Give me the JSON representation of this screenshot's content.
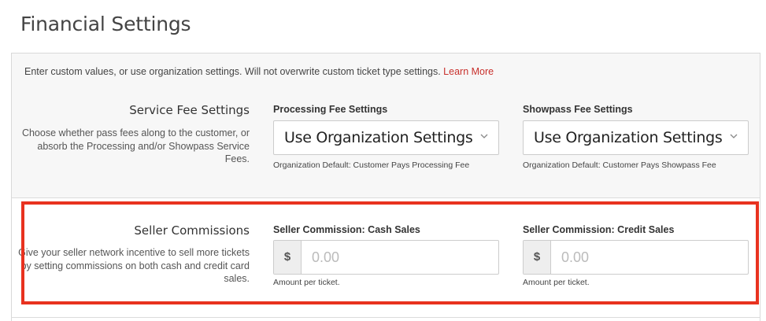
{
  "page": {
    "title": "Financial Settings"
  },
  "intro": {
    "text": "Enter custom values, or use organization settings. Will not overwrite custom ticket type settings. ",
    "link": "Learn More"
  },
  "service_fee": {
    "title": "Service Fee Settings",
    "description": "Choose whether pass fees along to the customer, or absorb the Processing and/or Showpass Service Fees.",
    "processing": {
      "label": "Processing Fee Settings",
      "value": "Use Organization Settings",
      "help": "Organization Default: Customer Pays Processing Fee"
    },
    "showpass": {
      "label": "Showpass Fee Settings",
      "value": "Use Organization Settings",
      "help": "Organization Default: Customer Pays Showpass Fee"
    }
  },
  "seller_commissions": {
    "title": "Seller Commissions",
    "description": "Give your seller network incentive to sell more tickets by setting commissions on both cash and credit card sales.",
    "cash": {
      "label": "Seller Commission: Cash Sales",
      "addon": "$",
      "placeholder": "0.00",
      "help": "Amount per ticket."
    },
    "credit": {
      "label": "Seller Commission: Credit Sales",
      "addon": "$",
      "placeholder": "0.00",
      "help": "Amount per ticket."
    }
  },
  "colors": {
    "link": "#c8302c",
    "highlight": "#e8321f",
    "panel_bg": "#f7f7f7"
  }
}
